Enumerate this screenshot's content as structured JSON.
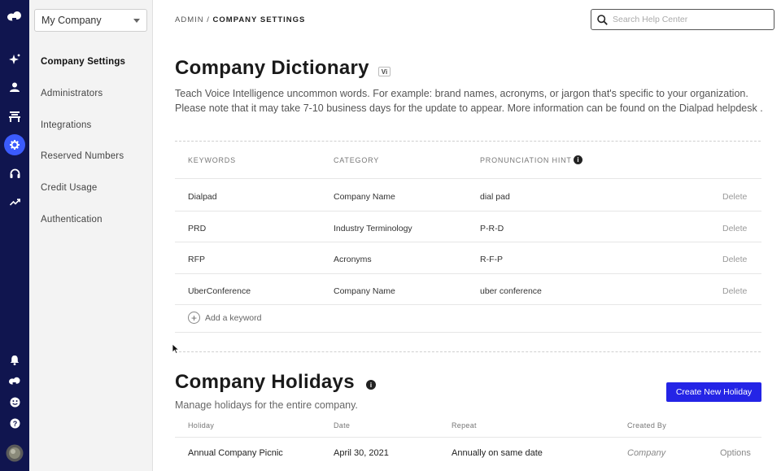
{
  "rail": {
    "items": [
      {
        "icon": "dialpad-logo-icon"
      },
      {
        "icon": "sparkle-icon"
      },
      {
        "icon": "user-icon"
      },
      {
        "icon": "office-icon"
      },
      {
        "icon": "gear-icon"
      },
      {
        "icon": "headset-icon"
      },
      {
        "icon": "trending-icon"
      },
      {
        "icon": "bell-icon"
      },
      {
        "icon": "dialpad-small-icon"
      },
      {
        "icon": "smiley-icon"
      },
      {
        "icon": "help-icon"
      },
      {
        "icon": "avatar-icon"
      }
    ],
    "bg_color": "#10154f",
    "active_color": "#3b5bfd"
  },
  "sidebar": {
    "company_select": "My Company",
    "items": [
      {
        "label": "Company Settings",
        "active": true
      },
      {
        "label": "Administrators"
      },
      {
        "label": "Integrations"
      },
      {
        "label": "Reserved Numbers"
      },
      {
        "label": "Credit Usage"
      },
      {
        "label": "Authentication"
      }
    ]
  },
  "header": {
    "breadcrumb_parent": "ADMIN /",
    "breadcrumb_current": "COMPANY SETTINGS",
    "search_placeholder": "Search Help Center"
  },
  "dictionary": {
    "title": "Company Dictionary",
    "badge": "Vi",
    "description": "Teach Voice Intelligence uncommon words. For example: brand names, acronyms, or jargon that's specific to your organization. Please note that it may take 7-10 business days for the update to appear. More information can be found on the Dialpad helpdesk .",
    "columns": [
      "KEYWORDS",
      "CATEGORY",
      "PRONUNCIATION HINT"
    ],
    "info_glyph": "i",
    "rows": [
      {
        "keyword": "Dialpad",
        "category": "Company Name",
        "hint": "dial pad",
        "action": "Delete"
      },
      {
        "keyword": "PRD",
        "category": "Industry Terminology",
        "hint": "P-R-D",
        "action": "Delete"
      },
      {
        "keyword": "RFP",
        "category": "Acronyms",
        "hint": "R-F-P",
        "action": "Delete"
      },
      {
        "keyword": "UberConference",
        "category": "Company Name",
        "hint": "uber conference",
        "action": "Delete"
      }
    ],
    "add_label": "Add a keyword"
  },
  "holidays": {
    "title": "Company Holidays",
    "info_glyph": "i",
    "subtitle": "Manage holidays for the entire company.",
    "create_button": "Create New Holiday",
    "button_color": "#2424e6",
    "columns": [
      "Holiday",
      "Date",
      "Repeat",
      "Created By"
    ],
    "rows": [
      {
        "holiday": "Annual Company Picnic",
        "date": "April 30, 2021",
        "repeat": "Annually on same date",
        "created_by": "Company",
        "action": "Options"
      }
    ]
  }
}
